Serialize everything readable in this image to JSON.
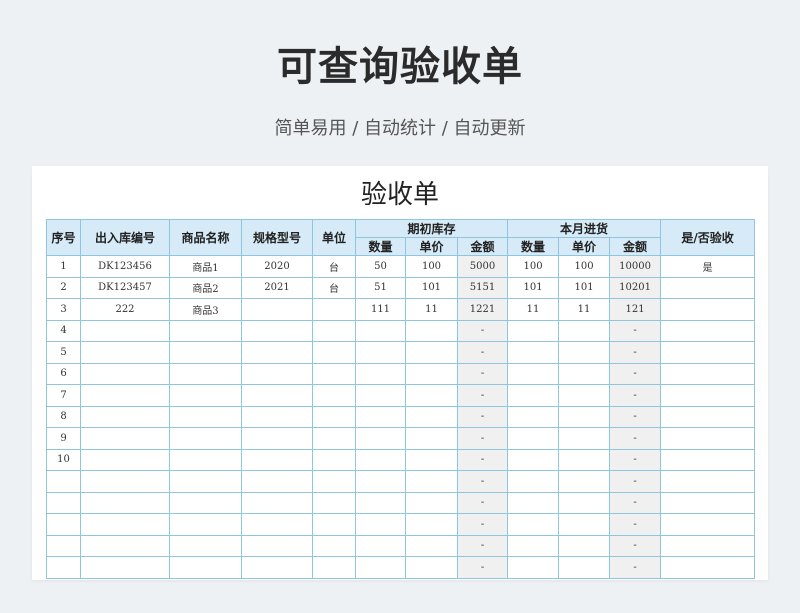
{
  "page": {
    "title": "可查询验收单",
    "subtitle": "简单易用 / 自动统计 / 自动更新"
  },
  "sheet": {
    "title": "验收单",
    "headers": {
      "seq": "序号",
      "order_no": "出入库编号",
      "product_name": "商品名称",
      "model": "规格型号",
      "unit": "单位",
      "opening": "期初库存",
      "incoming": "本月进货",
      "qty": "数量",
      "price": "单价",
      "amount": "金额",
      "accepted": "是/否验收"
    },
    "rows": [
      {
        "seq": "1",
        "order_no": "DK123456",
        "product_name": "商品1",
        "model": "2020",
        "unit": "台",
        "open_qty": "50",
        "open_price": "100",
        "open_amount": "5000",
        "in_qty": "100",
        "in_price": "100",
        "in_amount": "10000",
        "accepted": "是"
      },
      {
        "seq": "2",
        "order_no": "DK123457",
        "product_name": "商品2",
        "model": "2021",
        "unit": "台",
        "open_qty": "51",
        "open_price": "101",
        "open_amount": "5151",
        "in_qty": "101",
        "in_price": "101",
        "in_amount": "10201",
        "accepted": ""
      },
      {
        "seq": "3",
        "order_no": "222",
        "product_name": "商品3",
        "model": "",
        "unit": "",
        "open_qty": "111",
        "open_price": "11",
        "open_amount": "1221",
        "in_qty": "11",
        "in_price": "11",
        "in_amount": "121",
        "accepted": ""
      },
      {
        "seq": "4",
        "order_no": "",
        "product_name": "",
        "model": "",
        "unit": "",
        "open_qty": "",
        "open_price": "",
        "open_amount": "-",
        "in_qty": "",
        "in_price": "",
        "in_amount": "-",
        "accepted": ""
      },
      {
        "seq": "5",
        "order_no": "",
        "product_name": "",
        "model": "",
        "unit": "",
        "open_qty": "",
        "open_price": "",
        "open_amount": "-",
        "in_qty": "",
        "in_price": "",
        "in_amount": "-",
        "accepted": ""
      },
      {
        "seq": "6",
        "order_no": "",
        "product_name": "",
        "model": "",
        "unit": "",
        "open_qty": "",
        "open_price": "",
        "open_amount": "-",
        "in_qty": "",
        "in_price": "",
        "in_amount": "-",
        "accepted": ""
      },
      {
        "seq": "7",
        "order_no": "",
        "product_name": "",
        "model": "",
        "unit": "",
        "open_qty": "",
        "open_price": "",
        "open_amount": "-",
        "in_qty": "",
        "in_price": "",
        "in_amount": "-",
        "accepted": ""
      },
      {
        "seq": "8",
        "order_no": "",
        "product_name": "",
        "model": "",
        "unit": "",
        "open_qty": "",
        "open_price": "",
        "open_amount": "-",
        "in_qty": "",
        "in_price": "",
        "in_amount": "-",
        "accepted": ""
      },
      {
        "seq": "9",
        "order_no": "",
        "product_name": "",
        "model": "",
        "unit": "",
        "open_qty": "",
        "open_price": "",
        "open_amount": "-",
        "in_qty": "",
        "in_price": "",
        "in_amount": "-",
        "accepted": ""
      },
      {
        "seq": "10",
        "order_no": "",
        "product_name": "",
        "model": "",
        "unit": "",
        "open_qty": "",
        "open_price": "",
        "open_amount": "-",
        "in_qty": "",
        "in_price": "",
        "in_amount": "-",
        "accepted": ""
      },
      {
        "seq": "",
        "order_no": "",
        "product_name": "",
        "model": "",
        "unit": "",
        "open_qty": "",
        "open_price": "",
        "open_amount": "-",
        "in_qty": "",
        "in_price": "",
        "in_amount": "-",
        "accepted": ""
      },
      {
        "seq": "",
        "order_no": "",
        "product_name": "",
        "model": "",
        "unit": "",
        "open_qty": "",
        "open_price": "",
        "open_amount": "-",
        "in_qty": "",
        "in_price": "",
        "in_amount": "-",
        "accepted": ""
      },
      {
        "seq": "",
        "order_no": "",
        "product_name": "",
        "model": "",
        "unit": "",
        "open_qty": "",
        "open_price": "",
        "open_amount": "-",
        "in_qty": "",
        "in_price": "",
        "in_amount": "-",
        "accepted": ""
      },
      {
        "seq": "",
        "order_no": "",
        "product_name": "",
        "model": "",
        "unit": "",
        "open_qty": "",
        "open_price": "",
        "open_amount": "-",
        "in_qty": "",
        "in_price": "",
        "in_amount": "-",
        "accepted": ""
      },
      {
        "seq": "",
        "order_no": "",
        "product_name": "",
        "model": "",
        "unit": "",
        "open_qty": "",
        "open_price": "",
        "open_amount": "-",
        "in_qty": "",
        "in_price": "",
        "in_amount": "-",
        "accepted": ""
      }
    ]
  }
}
